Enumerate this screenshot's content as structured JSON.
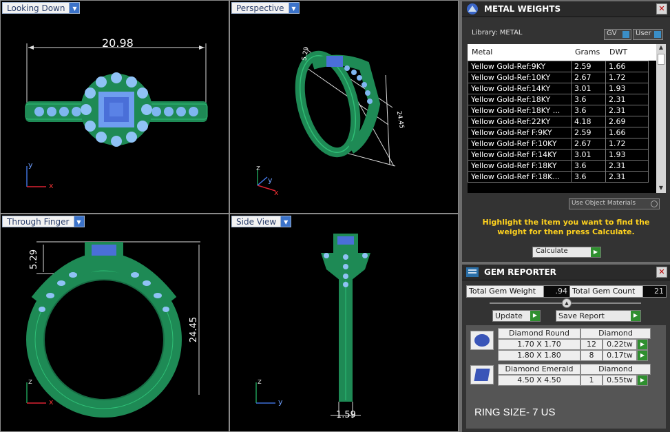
{
  "viewports": {
    "top_left": {
      "title": "Looking Down",
      "dim_width": "20.98",
      "axis_y": "y",
      "axis_x": "x"
    },
    "top_right": {
      "title": "Perspective",
      "dim_a": "5.29",
      "dim_b": "24.45",
      "axis_z": "z",
      "axis_y": "y",
      "axis_x": "x"
    },
    "bottom_left": {
      "title": "Through Finger",
      "dim_head": "5.29",
      "dim_height": "24.45",
      "axis_z": "z",
      "axis_x": "x"
    },
    "bottom_right": {
      "title": "Side View",
      "dim_shank": "1.59",
      "axis_z": "z",
      "axis_y": "y"
    }
  },
  "metal_weights": {
    "title": "METAL WEIGHTS",
    "library_label": "Library: METAL",
    "gv_label": "GV",
    "user_label": "User",
    "columns": [
      "Metal",
      "Grams",
      "DWT"
    ],
    "rows": [
      [
        "Yellow Gold-Ref:9KY",
        "2.59",
        "1.66"
      ],
      [
        "Yellow Gold-Ref:10KY",
        "2.67",
        "1.72"
      ],
      [
        "Yellow Gold-Ref:14KY",
        "3.01",
        "1.93"
      ],
      [
        "Yellow Gold-Ref:18KY",
        "3.6",
        "2.31"
      ],
      [
        "Yellow Gold-Ref:18KY ...",
        "3.6",
        "2.31"
      ],
      [
        "Yellow Gold-Ref:22KY",
        "4.18",
        "2.69"
      ],
      [
        "Yellow Gold-Ref F:9KY",
        "2.59",
        "1.66"
      ],
      [
        "Yellow Gold-Ref F:10KY",
        "2.67",
        "1.72"
      ],
      [
        "Yellow Gold-Ref F:14KY",
        "3.01",
        "1.93"
      ],
      [
        "Yellow Gold-Ref F:18KY",
        "3.6",
        "2.31"
      ],
      [
        "Yellow Gold-Ref F:18K...",
        "3.6",
        "2.31"
      ]
    ],
    "use_object_materials": "Use Object Materials",
    "instruction": "Highlight the item you want to find the weight for then press Calculate.",
    "calculate_label": "Calculate"
  },
  "gem_reporter": {
    "title": "GEM REPORTER",
    "total_weight_label": "Total Gem Weight",
    "total_weight_value": ".94",
    "total_count_label": "Total Gem Count",
    "total_count_value": "21",
    "update_label": "Update",
    "save_report_label": "Save Report",
    "groups": [
      {
        "shape": "Diamond Round",
        "type": "Diamond",
        "rows": [
          [
            "1.70 X 1.70",
            "12",
            "0.22tw"
          ],
          [
            "1.80 X 1.80",
            "8",
            "0.17tw"
          ]
        ]
      },
      {
        "shape": "Diamond Emerald",
        "type": "Diamond",
        "rows": [
          [
            "4.50 X 4.50",
            "1",
            "0.55tw"
          ]
        ]
      }
    ],
    "ring_size": "RING SIZE- 7 US"
  },
  "colors": {
    "ring": "#1e8a55",
    "stone": "#4a6fd8",
    "accent_text": "#ffd21e"
  }
}
